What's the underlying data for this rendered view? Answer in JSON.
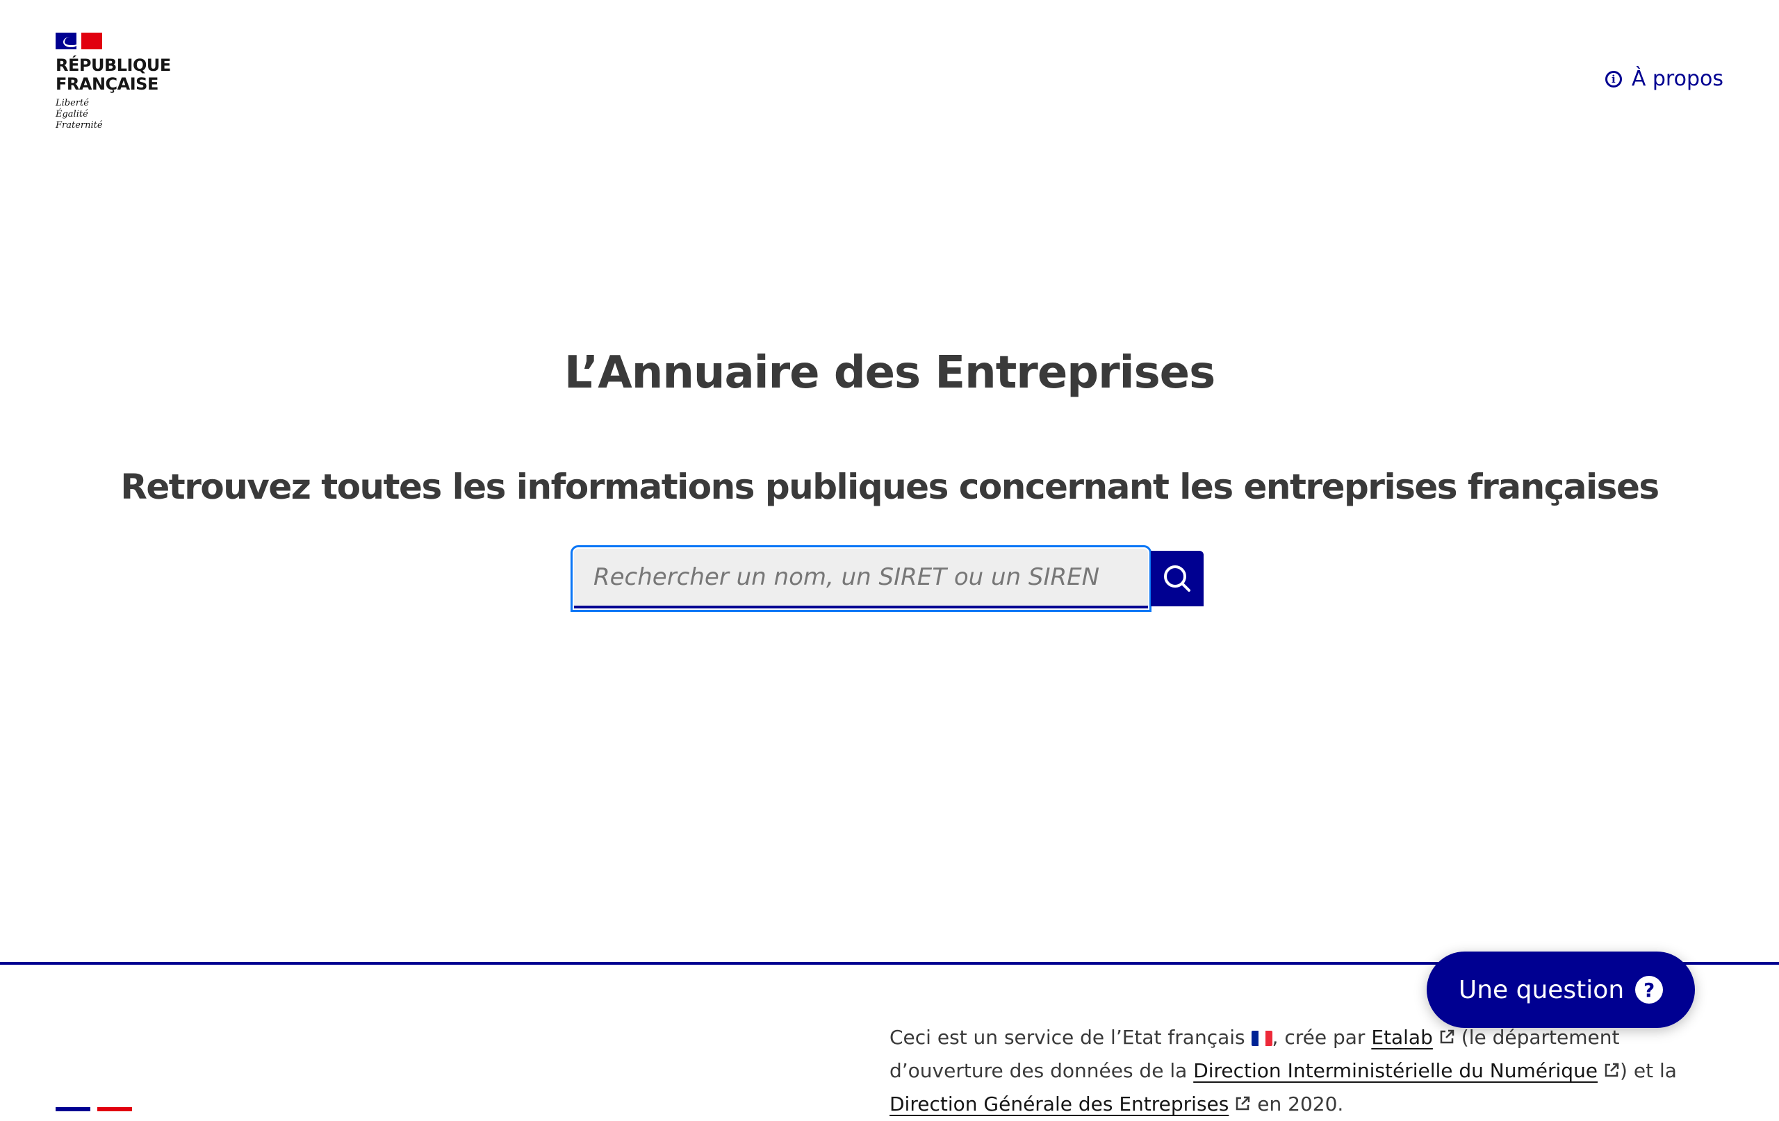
{
  "header": {
    "logo_line1": "RÉPUBLIQUE",
    "logo_line2": "FRANÇAISE",
    "motto_1": "Liberté",
    "motto_2": "Égalité",
    "motto_3": "Fraternité",
    "about_label": "À propos"
  },
  "hero": {
    "title": "L’Annuaire des Entreprises",
    "subtitle": "Retrouvez toutes les informations publiques concernant les entreprises françaises"
  },
  "search": {
    "placeholder": "Rechercher un nom, un SIRET ou un SIREN",
    "value": ""
  },
  "footer": {
    "text_1": "Ceci est un service de l’Etat français",
    "text_2": ", crée par",
    "link_etalab": "Etalab",
    "text_3": "(le département d’ouverture des données de la",
    "link_dinum": "Direction Interministérielle du Numérique",
    "text_4": ") et la",
    "link_dge": "Direction Générale des Entreprises",
    "text_5": "en 2020."
  },
  "help": {
    "label": "Une question",
    "icon_glyph": "?"
  },
  "colors": {
    "brand_blue": "#000091",
    "brand_red": "#e1000f",
    "focus_outline": "#0a76f6",
    "text": "#3a3a3a"
  },
  "icons": {
    "about": "info-icon",
    "search": "search-icon",
    "external": "external-link-icon",
    "help": "question-icon"
  }
}
